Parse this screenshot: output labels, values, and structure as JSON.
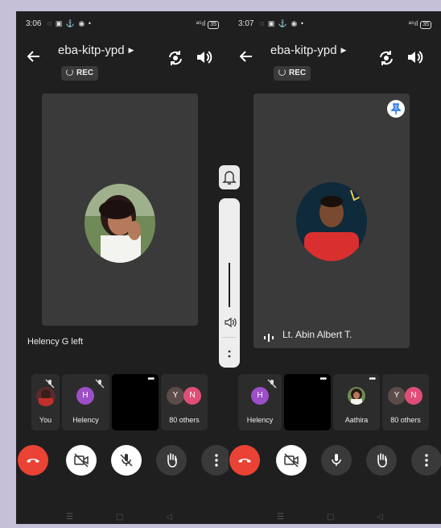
{
  "left": {
    "status": {
      "time": "3:06",
      "battery": "35"
    },
    "meeting_code": "eba-kitp-ypd",
    "rec_label": "REC",
    "left_notice": "Helency G left",
    "chips": [
      {
        "label": "You"
      },
      {
        "label": "Helency",
        "initial": "H"
      },
      {
        "label": ""
      },
      {
        "label": "80 others",
        "initials": [
          "Y",
          "N"
        ]
      }
    ]
  },
  "right": {
    "status": {
      "time": "3:07",
      "battery": "35"
    },
    "meeting_code": "eba-kitp-ypd",
    "rec_label": "REC",
    "speaker_name": "Lt. Abin Albert T.",
    "chips": [
      {
        "label": "Helency",
        "initial": "H"
      },
      {
        "label": ""
      },
      {
        "label": "Aathira"
      },
      {
        "label": "80 others",
        "initials": [
          "Y",
          "N"
        ]
      }
    ]
  },
  "colors": {
    "end_call": "#ea4335",
    "avatar_h": "#9c4fc6",
    "avatar_y": "#5b4c4a",
    "avatar_n": "#e04e78",
    "surface": "#1f1f20",
    "tile": "#3a3a3b"
  },
  "icons": [
    "back-arrow-icon",
    "camera-switch-icon",
    "speaker-icon",
    "mic-off-icon",
    "camera-off-icon",
    "hand-icon",
    "more-icon",
    "end-call-icon",
    "bell-icon",
    "mic-icon"
  ]
}
